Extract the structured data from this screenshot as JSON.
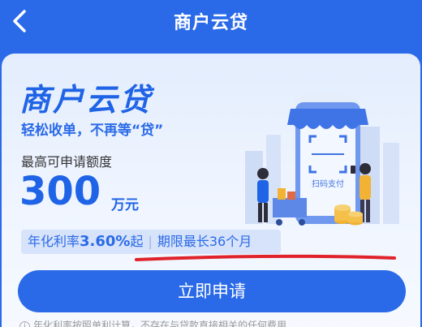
{
  "header": {
    "title": "商户云贷"
  },
  "hero": {
    "brand": "商户云贷",
    "slogan": "轻松收单，不再等“贷”",
    "scan_label": "扫码支付"
  },
  "quota": {
    "label": "最高可申请额度",
    "amount": "300",
    "unit": "万元"
  },
  "rate": {
    "prefix": "年化利率",
    "value": "3.60%",
    "suffix": "起",
    "term": "期限最长36个月"
  },
  "apply_button": "立即申请",
  "notice": "年化利率按照单利计算，不存在与贷款直接相关的任何费用",
  "colors": {
    "primary": "#2a6ae8",
    "annotation": "#e0222a"
  }
}
